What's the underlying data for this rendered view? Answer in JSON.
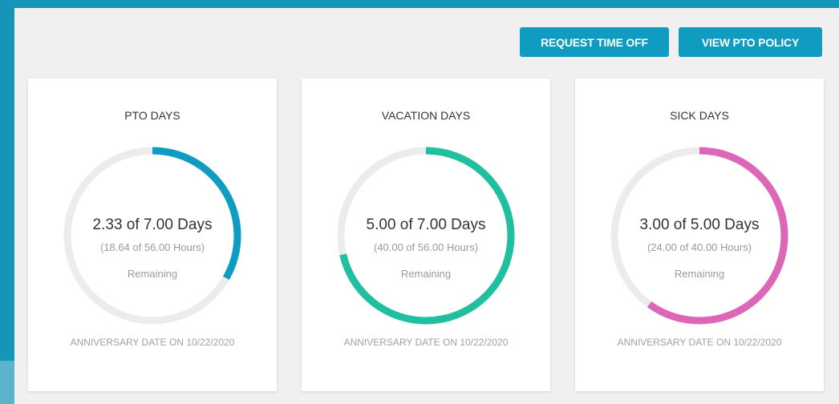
{
  "actions": {
    "request_label": "REQUEST TIME OFF",
    "policy_label": "VIEW PTO POLICY"
  },
  "cards": [
    {
      "title": "PTO DAYS",
      "days_text": "2.33 of 7.00 Days",
      "hours_text": "(18.64 of 56.00 Hours)",
      "remaining_label": "Remaining",
      "anniversary": "ANNIVERSARY DATE ON 10/22/2020",
      "fraction_remaining": 0.333,
      "color": "#0e9cc3"
    },
    {
      "title": "VACATION DAYS",
      "days_text": "5.00 of 7.00 Days",
      "hours_text": "(40.00 of 56.00 Hours)",
      "remaining_label": "Remaining",
      "anniversary": "ANNIVERSARY DATE ON 10/22/2020",
      "fraction_remaining": 0.714,
      "color": "#1fbf9f"
    },
    {
      "title": "SICK DAYS",
      "days_text": "3.00 of 5.00 Days",
      "hours_text": "(24.00 of 40.00 Hours)",
      "remaining_label": "Remaining",
      "anniversary": "ANNIVERSARY DATE ON 10/22/2020",
      "fraction_remaining": 0.6,
      "color": "#dc67b9"
    }
  ],
  "ring_track_color": "#ececec"
}
